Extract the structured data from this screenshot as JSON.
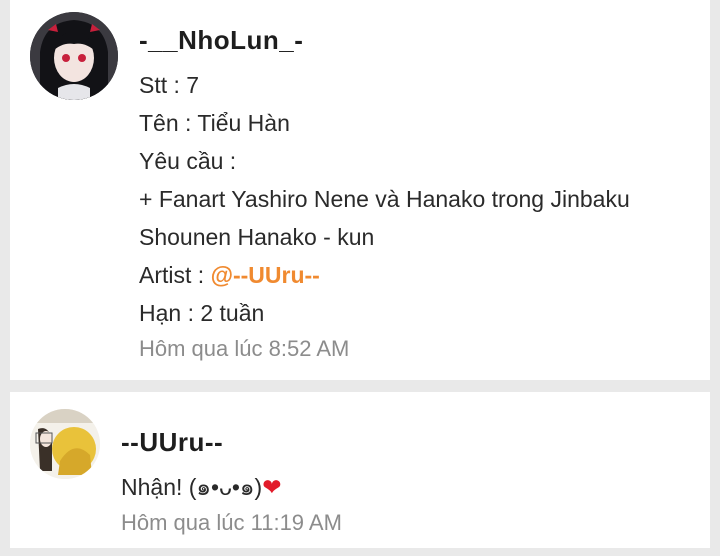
{
  "comments": [
    {
      "username": "-__NhoLun_-",
      "lines": {
        "stt": "Stt : 7",
        "ten": "Tên : Tiểu Hàn",
        "yeucau": "Yêu cầu :",
        "request1": "+ Fanart Yashiro Nene và Hanako trong Jinbaku",
        "request2": "Shounen Hanako - kun",
        "artist_prefix": "Artist : ",
        "artist_mention": "@--UUru--",
        "han": "Hạn : 2 tuần"
      },
      "timestamp": "Hôm qua lúc 8:52 AM"
    },
    {
      "username": "--UUru--",
      "message": "Nhận! (๑•ᴗ•๑)",
      "emoji": "❤",
      "timestamp": "Hôm qua lúc 11:19 AM"
    }
  ],
  "colors": {
    "mention": "#f08a30",
    "timestamp": "#8c8c8c",
    "heart": "#e21b2a"
  }
}
